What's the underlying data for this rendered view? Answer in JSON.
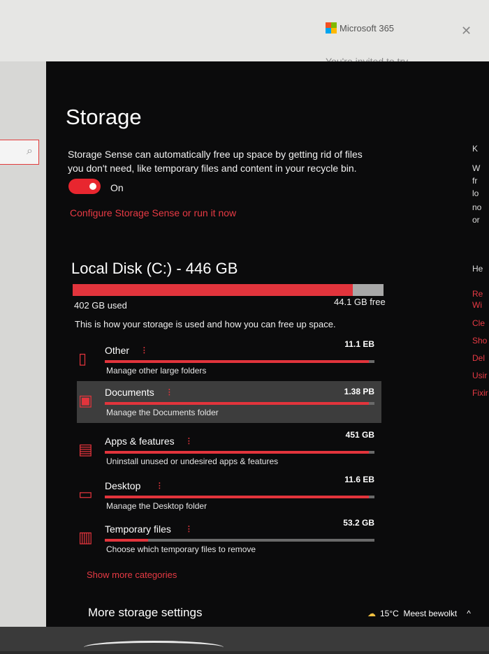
{
  "window": {
    "app_title": "Microsoft 365",
    "notice": "You're invited to try"
  },
  "page_title": "Storage",
  "storage_sense": {
    "description": "Storage Sense can automatically free up space by getting rid of files you don't need, like temporary files and content in your recycle bin.",
    "toggle_state": "On",
    "configure_link": "Configure Storage Sense or run it now"
  },
  "disk": {
    "title": "Local Disk (C:) - 446 GB",
    "used_label": "402 GB used",
    "free_label": "44.1 GB free",
    "used_fraction": 0.9,
    "description": "This is how your storage is used and how you can free up space."
  },
  "categories": [
    {
      "name": "Other",
      "size": "11.1 EB",
      "action": "Manage other large folders",
      "fill": 0.98,
      "icon": "folder-icon"
    },
    {
      "name": "Documents",
      "size": "1.38 PB",
      "action": "Manage the Documents folder",
      "fill": 0.98,
      "icon": "documents-icon"
    },
    {
      "name": "Apps & features",
      "size": "451 GB",
      "action": "Uninstall unused or undesired apps & features",
      "fill": 0.98,
      "icon": "apps-icon"
    },
    {
      "name": "Desktop",
      "size": "11.6 EB",
      "action": "Manage the Desktop folder",
      "fill": 0.98,
      "icon": "desktop-icon"
    },
    {
      "name": "Temporary files",
      "size": "53.2 GB",
      "action": "Choose which temporary files to remove",
      "fill": 0.16,
      "icon": "trash-icon"
    }
  ],
  "show_more": "Show more categories",
  "more_settings": "More storage settings",
  "right_column": [
    "K",
    "W",
    "fr",
    "lo",
    "no",
    "or",
    "He",
    "Re",
    "Wi",
    "Cle",
    "Sho",
    "Del",
    "Usir",
    "Fixir"
  ],
  "taskbar": {
    "temperature": "15°C",
    "weather": "Meest bewolkt"
  },
  "colors": {
    "accent": "#e2343c",
    "panel_bg": "#0b0b0c",
    "text": "#ffffff"
  }
}
